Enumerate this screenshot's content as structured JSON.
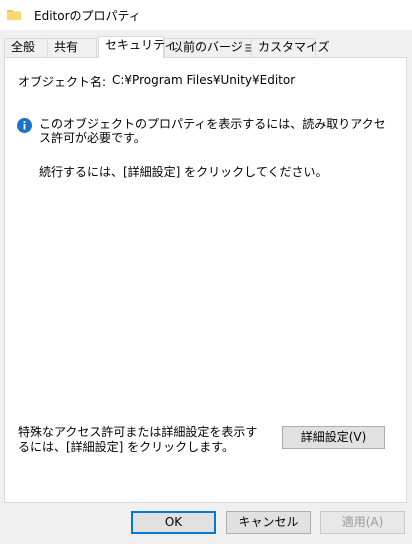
{
  "window": {
    "title": "Editorのプロパティ"
  },
  "tabs": [
    {
      "label": "全般"
    },
    {
      "label": "共有"
    },
    {
      "label": "セキュリティ"
    },
    {
      "label": "以前のバージョン"
    },
    {
      "label": "カスタマイズ"
    }
  ],
  "security": {
    "object_name_label": "オブジェクト名:",
    "object_name_value": "C:¥Program Files¥Unity¥Editor",
    "info_message": "このオブジェクトのプロパティを表示するには、読み取りアクセス許可が必要です。",
    "continue_message": "続行するには、[詳細設定] をクリックしてください。",
    "advanced_hint": "特殊なアクセス許可または詳細設定を表示するには、[詳細設定] をクリックします。",
    "advanced_button": "詳細設定(V)"
  },
  "footer": {
    "ok_label": "OK",
    "cancel_label": "キャンセル",
    "apply_label": "適用(A)"
  },
  "colors": {
    "info_icon": "#1a73c8",
    "folder_icon": "#f5c542",
    "default_button_border": "#0078d7"
  }
}
